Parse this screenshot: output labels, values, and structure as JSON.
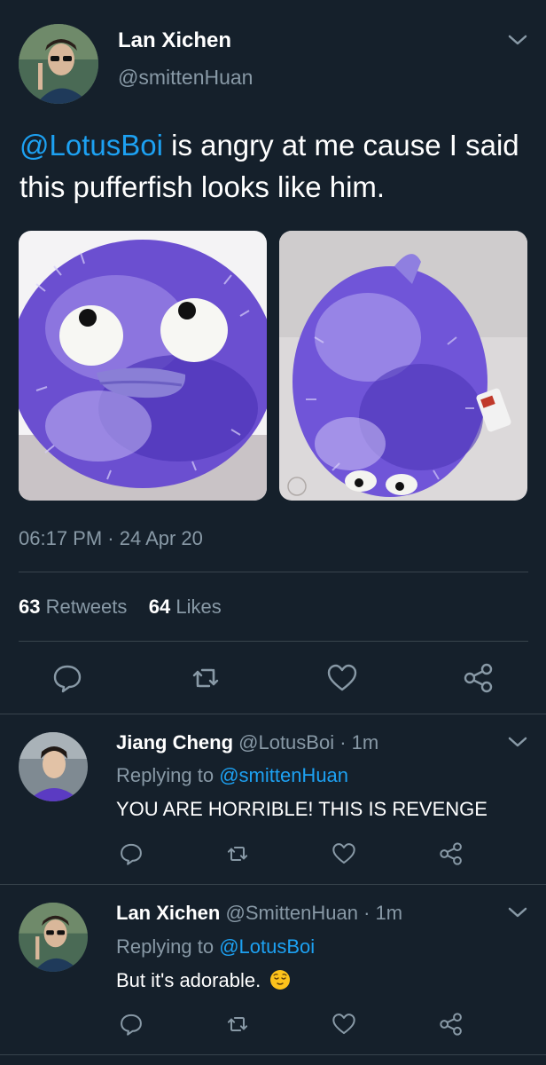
{
  "main_tweet": {
    "author_name": "Lan Xichen",
    "author_handle": "@smittenHuan",
    "mention": "@LotusBoi",
    "text": " is angry at me cause I said this pufferfish looks like him.",
    "timestamp": "06:17 PM · 24 Apr 20",
    "retweets_count": "63",
    "retweets_label": "Retweets",
    "likes_count": "64",
    "likes_label": "Likes",
    "media_icon_names": [
      "purple-pufferfish-plush-photo",
      "purple-pufferfish-plush-back-photo"
    ]
  },
  "replies": [
    {
      "author_name": "Jiang Cheng",
      "author_handle": "@LotusBoi",
      "time": " · 1m",
      "replying_prefix": "Replying to ",
      "replying_to": "@smittenHuan",
      "text": "YOU ARE HORRIBLE! THIS IS REVENGE"
    },
    {
      "author_name": "Lan Xichen",
      "author_handle": "@SmittenHuan",
      "time": " · 1m",
      "replying_prefix": "Replying to ",
      "replying_to": "@LotusBoi",
      "text": "But it's adorable. "
    }
  ],
  "icons": [
    "chevron-down-icon",
    "reply-icon",
    "retweet-icon",
    "like-icon",
    "share-icon",
    "relieved-face-emoji"
  ],
  "colors": {
    "background": "#15202b",
    "text": "#ffffff",
    "muted": "#8899a6",
    "link": "#1da1f2",
    "divider": "#38444d",
    "plush_purple": "#7b5cd6"
  }
}
